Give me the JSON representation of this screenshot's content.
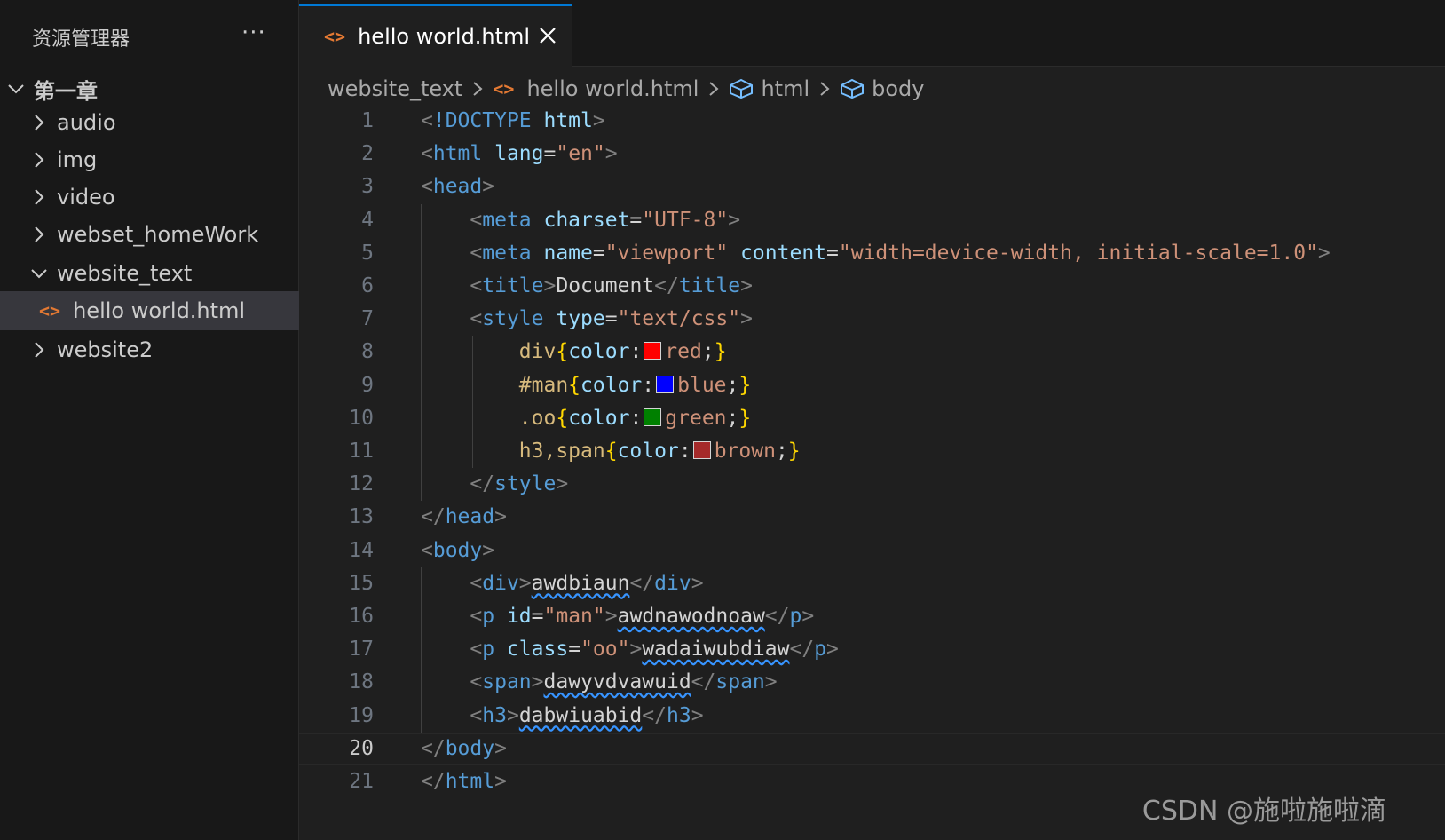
{
  "sidebar": {
    "title": "资源管理器",
    "more_label": "···",
    "tree": [
      {
        "label": "第一章"
      },
      {
        "label": "audio"
      },
      {
        "label": "img"
      },
      {
        "label": "video"
      },
      {
        "label": "webset_homeWork"
      },
      {
        "label": "website_text"
      },
      {
        "label": "hello world.html"
      },
      {
        "label": "website2"
      }
    ]
  },
  "tab": {
    "label": "hello world.html",
    "icon": "<>"
  },
  "breadcrumb": [
    "website_text",
    "hello world.html",
    "html",
    "body"
  ],
  "editor": {
    "current_line": "20",
    "lines": [
      {
        "n": "1",
        "tokens": [
          "<",
          "!DOCTYPE",
          " html",
          ">"
        ]
      },
      {
        "n": "2",
        "tokens": [
          "<",
          "html",
          " lang",
          "=",
          "\"en\"",
          ">"
        ]
      },
      {
        "n": "3",
        "tokens": [
          "<",
          "head",
          ">"
        ]
      },
      {
        "n": "4",
        "tokens": [
          "    ",
          "<",
          "meta",
          " charset",
          "=",
          "\"UTF-8\"",
          ">"
        ]
      },
      {
        "n": "5",
        "tokens": [
          "    ",
          "<",
          "meta",
          " name",
          "=",
          "\"viewport\"",
          " content",
          "=",
          "\"width=device-width, initial-scale=1.0\"",
          ">"
        ]
      },
      {
        "n": "6",
        "tokens": [
          "    ",
          "<",
          "title",
          ">",
          "Document",
          "</",
          "title",
          ">"
        ]
      },
      {
        "n": "7",
        "tokens": [
          "    ",
          "<",
          "style",
          " type",
          "=",
          "\"text/css\"",
          ">"
        ]
      },
      {
        "n": "8",
        "tokens": [
          "        ",
          "div",
          "{",
          "color",
          ":",
          "red",
          ";",
          "}"
        ]
      },
      {
        "n": "9",
        "tokens": [
          "        ",
          "#man",
          "{",
          "color",
          ":",
          "blue",
          ";",
          "}"
        ]
      },
      {
        "n": "10",
        "tokens": [
          "        ",
          ".oo",
          "{",
          "color",
          ":",
          "green",
          ";",
          "}"
        ]
      },
      {
        "n": "11",
        "tokens": [
          "        ",
          "h3,span",
          "{",
          "color",
          ":",
          "brown",
          ";",
          "}"
        ]
      },
      {
        "n": "12",
        "tokens": [
          "    ",
          "</",
          "style",
          ">"
        ]
      },
      {
        "n": "13",
        "tokens": [
          "</",
          "head",
          ">"
        ]
      },
      {
        "n": "14",
        "tokens": [
          "<",
          "body",
          ">"
        ]
      },
      {
        "n": "15",
        "tokens": [
          "    ",
          "<",
          "div",
          ">",
          "awdbiaun",
          "</",
          "div",
          ">"
        ]
      },
      {
        "n": "16",
        "tokens": [
          "    ",
          "<",
          "p",
          " id",
          "=",
          "\"man\"",
          ">",
          "awdnawodnoaw",
          "</",
          "p",
          ">"
        ]
      },
      {
        "n": "17",
        "tokens": [
          "    ",
          "<",
          "p",
          " class",
          "=",
          "\"oo\"",
          ">",
          "wadaiwubdiaw",
          "</",
          "p",
          ">"
        ]
      },
      {
        "n": "18",
        "tokens": [
          "    ",
          "<",
          "span",
          ">",
          "dawyvdvawuid",
          "</",
          "span",
          ">"
        ]
      },
      {
        "n": "19",
        "tokens": [
          "    ",
          "<",
          "h3",
          ">",
          "dabwiuabid",
          "</",
          "h3",
          ">"
        ]
      },
      {
        "n": "20",
        "tokens": [
          "</",
          "body",
          ">"
        ]
      },
      {
        "n": "21",
        "tokens": [
          "</",
          "html",
          ">"
        ]
      }
    ]
  },
  "colors": {
    "red": "#ff0000",
    "blue": "#0000ff",
    "green": "#008000",
    "brown": "#a52a2a",
    "accent": "#0078d4",
    "file_icon": "#e37933"
  },
  "watermark": "CSDN @施啦施啦滴"
}
